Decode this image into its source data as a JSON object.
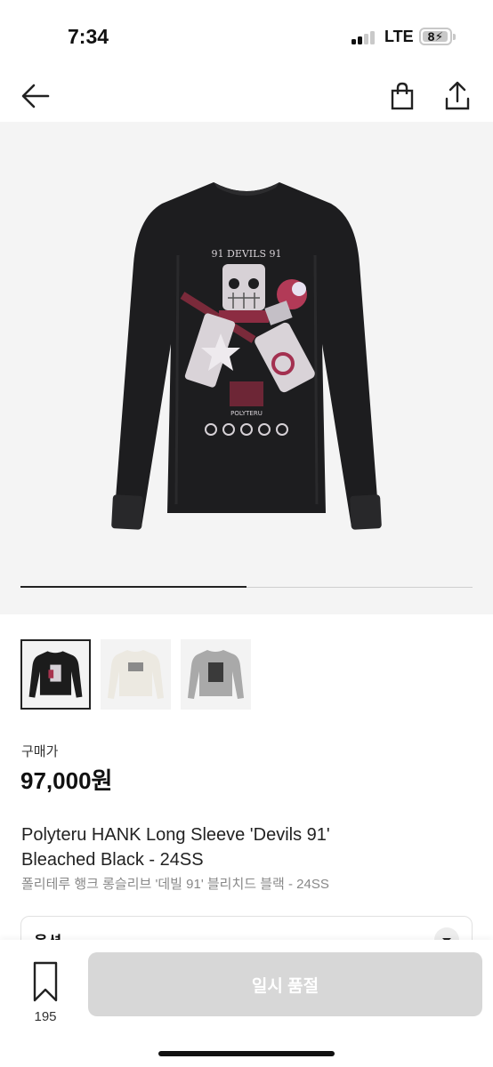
{
  "status_bar": {
    "time": "7:34",
    "network": "LTE",
    "battery": "8",
    "battery_icon": "charging-bolt"
  },
  "nav": {
    "back_icon": "arrow-left-icon",
    "cart_icon": "shopping-bag-icon",
    "share_icon": "share-icon"
  },
  "product_image": {
    "print_text_top": "91 DEVILS 91",
    "print_text_band": "POLYTERU",
    "carousel_position": 0.5,
    "carousel_count": 2
  },
  "thumbnails": [
    {
      "color": "#1c1c1c",
      "name": "black"
    },
    {
      "color": "#ece9e1",
      "name": "cream"
    },
    {
      "color": "#a9a9a9",
      "name": "gray"
    }
  ],
  "price": {
    "label": "구매가",
    "value": "97,000원"
  },
  "product": {
    "title_line1": "Polyteru HANK Long Sleeve 'Devils 91'",
    "title_line2": "Bleached Black - 24SS",
    "title_ko": "폴리테루 행크 롱슬리브 '데빌 91' 블리치드 블랙 - 24SS"
  },
  "option": {
    "label": "옵션"
  },
  "bottom": {
    "wish_count": "195",
    "button_label": "일시 품절"
  },
  "colors": {
    "accent_disabled": "#d7d7d7",
    "text_primary": "#111111",
    "text_secondary": "#888888"
  }
}
